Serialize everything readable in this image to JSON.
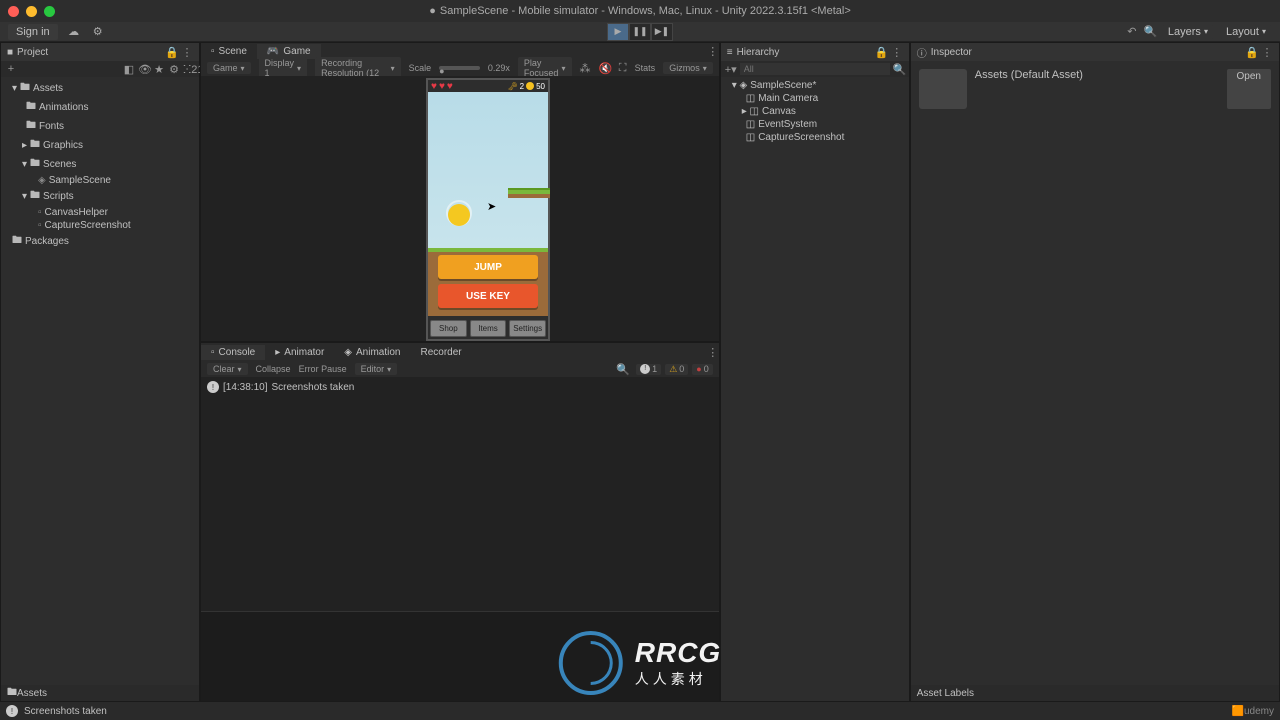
{
  "titlebar": {
    "title": "SampleScene - Mobile simulator - Windows, Mac, Linux - Unity 2022.3.15f1 <Metal>"
  },
  "toolbar": {
    "signin": "Sign in",
    "layers": "Layers",
    "layout": "Layout"
  },
  "project": {
    "header": "Project",
    "search_count": "21",
    "root": "Assets",
    "folders": {
      "animations": "Animations",
      "fonts": "Fonts",
      "graphics": "Graphics",
      "scenes": "Scenes",
      "scripts": "Scripts"
    },
    "files": {
      "samplescene": "SampleScene",
      "canvashelper": "CanvasHelper",
      "capturescreenshot": "CaptureScreenshot"
    },
    "packages": "Packages"
  },
  "tabs": {
    "scene": "Scene",
    "game": "Game"
  },
  "game_toolbar": {
    "game": "Game",
    "display": "Display 1",
    "resolution": "Recording Resolution (12",
    "scale": "Scale",
    "scale_val": "0.29x",
    "play_focused": "Play Focused",
    "stats": "Stats",
    "gizmos": "Gizmos"
  },
  "mobile_game": {
    "hearts": 3,
    "keys": "2",
    "coins": "50",
    "btn_jump": "JUMP",
    "btn_usekey": "USE KEY",
    "btn_shop": "Shop",
    "btn_items": "Items",
    "btn_settings": "Settings"
  },
  "hierarchy": {
    "header": "Hierarchy",
    "search_placeholder": "All",
    "scene": "SampleScene*",
    "items": {
      "camera": "Main Camera",
      "canvas": "Canvas",
      "eventsystem": "EventSystem",
      "capture": "CaptureScreenshot"
    }
  },
  "inspector": {
    "header": "Inspector",
    "asset_text": "Assets (Default Asset)",
    "open": "Open"
  },
  "console": {
    "tab_console": "Console",
    "tab_animator": "Animator",
    "tab_animation": "Animation",
    "tab_recorder": "Recorder",
    "clear": "Clear",
    "collapse": "Collapse",
    "error_pause": "Error Pause",
    "editor": "Editor",
    "info_count": "1",
    "warn_count": "0",
    "err_count": "0",
    "log_time": "[14:38:10]",
    "log_msg": "Screenshots taken"
  },
  "footer": {
    "assets": "Assets",
    "asset_labels": "Asset Labels",
    "status": "Screenshots taken",
    "brand": "udemy"
  },
  "watermark": {
    "big": "RRCG",
    "sub": "人人素材"
  }
}
